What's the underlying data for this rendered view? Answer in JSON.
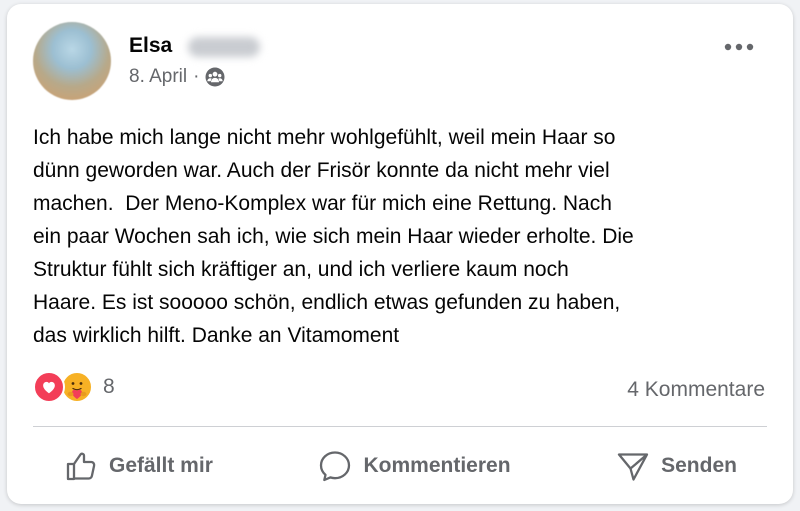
{
  "post": {
    "author": {
      "name": "Elsa"
    },
    "date": "8. April",
    "separator": "·",
    "audience_icon": "friends-icon",
    "more_icon": "more-horizontal-icon",
    "text": "Ich habe mich lange nicht mehr wohlgefühlt, weil mein Haar so\ndünn geworden war. Auch der Frisör konnte da nicht mehr viel\nmachen.  Der Meno-Komplex war für mich eine Rettung. Nach\nein paar Wochen sah ich, wie sich mein Haar wieder erholte. Die\nStruktur fühlt sich kräftiger an, und ich verliere kaum noch\nHaare. Es ist sooooo schön, endlich etwas gefunden zu haben,\ndas wirklich hilft. Danke an Vitamoment",
    "reactions": {
      "types": [
        "love",
        "care"
      ],
      "count": "8"
    },
    "comments_label": "4 Kommentare"
  },
  "actions": {
    "like_label": "Gefällt mir",
    "comment_label": "Kommentieren",
    "share_label": "Senden"
  },
  "colors": {
    "text": "#050505",
    "secondary": "#65676b",
    "love": "#f33e58",
    "care": "#f7b125",
    "divider": "#ced0d4"
  }
}
